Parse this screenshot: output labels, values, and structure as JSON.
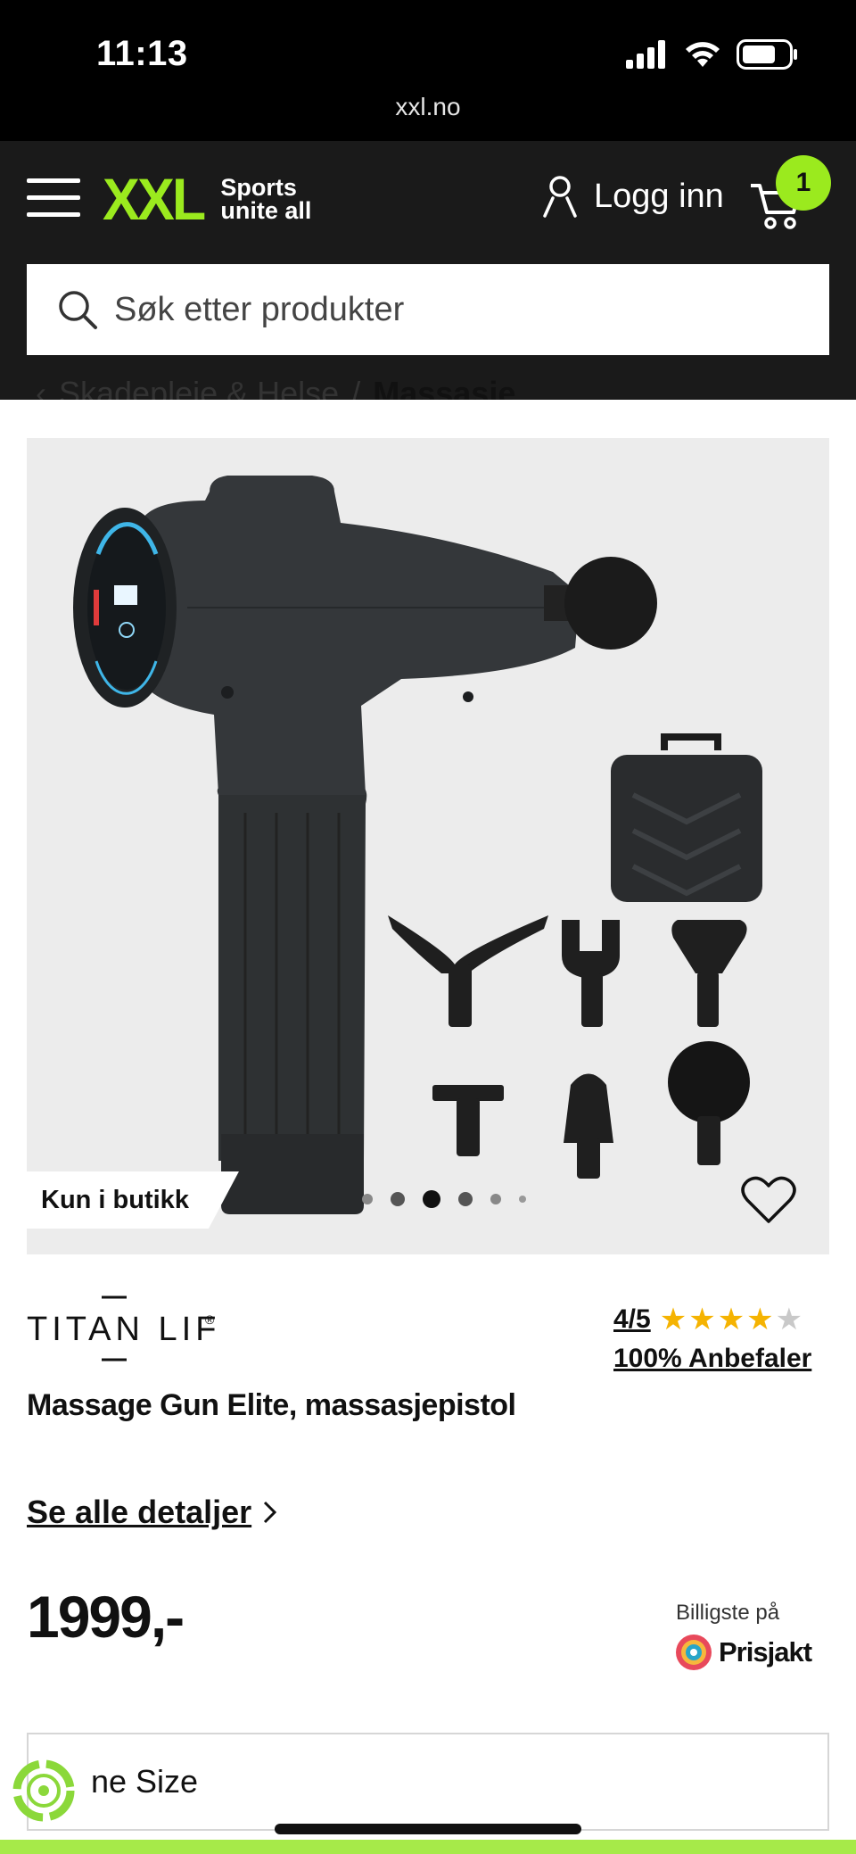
{
  "status_bar": {
    "time": "11:13",
    "url": "xxl.no",
    "icons": [
      "signal-icon",
      "wifi-icon",
      "battery-icon"
    ]
  },
  "header": {
    "logo_text": "XXL",
    "logo_tagline_1": "Sports",
    "logo_tagline_2": "unite all",
    "login_label": "Logg inn",
    "cart_count": "1",
    "search_placeholder": "Søk etter produkter",
    "accent_color": "#9bea1e"
  },
  "breadcrumb": {
    "parent": "Skadepleie & Helse",
    "separator": "/",
    "current": "Massasje"
  },
  "product": {
    "badge": "Kun i butikk",
    "image_slide_count": 6,
    "active_slide": 3,
    "brand": "TITAN LIFE",
    "brand_mark": "®",
    "rating_text": "4/5",
    "rating_value": 4,
    "rating_max": 5,
    "recommend_text": "100% Anbefaler",
    "title": "Massage Gun Elite, massasjepistol",
    "details_link": "Se alle detaljer",
    "price": "1999,-",
    "prisjakt_top": "Billigste på",
    "prisjakt_name": "Prisjakt",
    "size_label": "ne Size"
  }
}
